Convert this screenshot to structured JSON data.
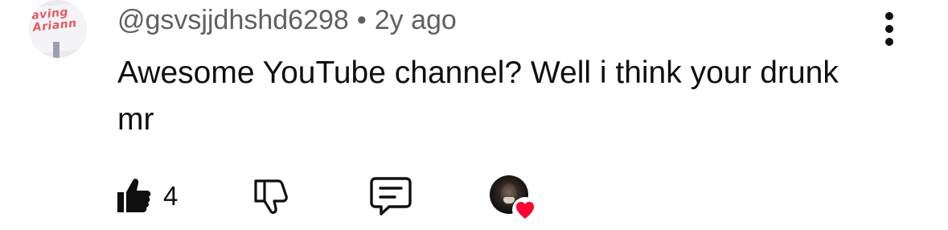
{
  "comment": {
    "author_handle": "@gsvsjjdhshd6298",
    "separator": "•",
    "timestamp": "2y ago",
    "text": "Awesome YouTube channel? Well i think your drunk mr",
    "avatar_sign_text": [
      "aving",
      "Ariann"
    ]
  },
  "actions": {
    "like_count": "4",
    "like_icon": "thumbs-up-filled-icon",
    "dislike_icon": "thumbs-down-outline-icon",
    "reply_icon": "comment-bubble-icon",
    "creator_heart_icon": "creator-heart-icon",
    "menu_icon": "more-vertical-icon"
  },
  "colors": {
    "primary_text": "#0f0f0f",
    "secondary_text": "#606060",
    "heart": "#ff0033",
    "sign_text": "#e45a62"
  }
}
